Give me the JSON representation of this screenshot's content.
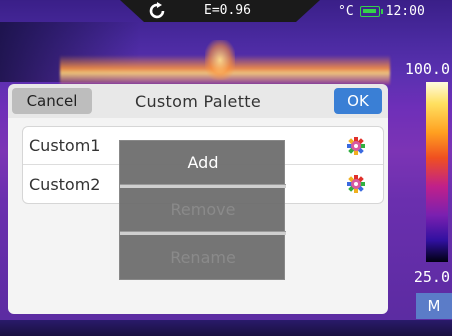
{
  "status_bar": {
    "refresh_icon": "refresh-icon",
    "emissivity": "E=0.96",
    "unit": "°C",
    "battery_icon": "battery-icon",
    "time": "12:00"
  },
  "scale": {
    "max": "100.0",
    "min": "25.0",
    "mode": "M"
  },
  "dialog": {
    "cancel_label": "Cancel",
    "title": "Custom Palette",
    "ok_label": "OK",
    "palettes": [
      {
        "name": "Custom1",
        "icon": "palette-gear-icon"
      },
      {
        "name": "Custom2",
        "icon": "palette-gear-icon"
      }
    ]
  },
  "context_menu": {
    "items": [
      {
        "label": "Add",
        "enabled": true
      },
      {
        "label": "Remove",
        "enabled": false
      },
      {
        "label": "Rename",
        "enabled": false
      }
    ]
  },
  "colors": {
    "ok_button": "#3a7fd5",
    "cancel_button": "#bdbdbd",
    "mode_badge": "#5b7cc8",
    "battery": "#35d04a"
  }
}
